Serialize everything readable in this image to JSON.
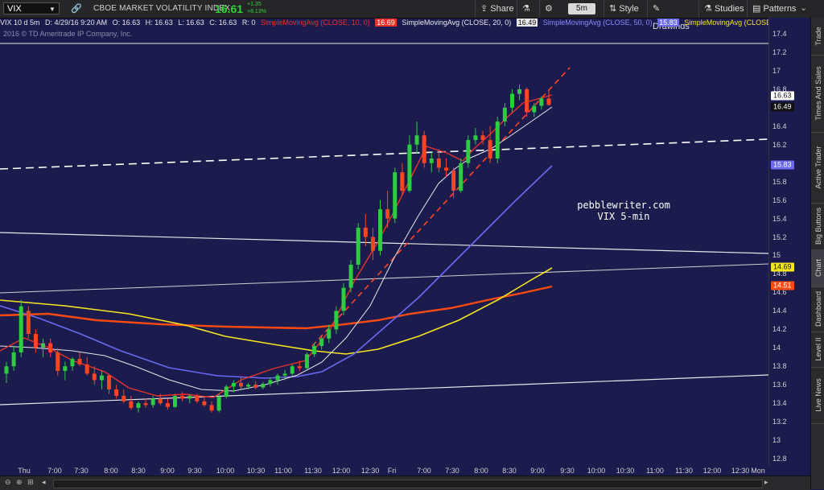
{
  "toolbar": {
    "symbol": "VIX",
    "description": "CBOE MARKET VOLATILITY INDEX",
    "last_price": "16.61",
    "change": "+1.35",
    "change_pct": "+8.13%",
    "share_label": "Share",
    "timeframe": "5m",
    "style_label": "Style",
    "drawings_label": "Drawings",
    "studies_label": "Studies",
    "patterns_label": "Patterns"
  },
  "info_bar": {
    "chart_desc": "VIX 10 d 5m",
    "datetime": "D: 4/29/16 9:20 AM",
    "open": "O: 16.63",
    "high": "H: 16.63",
    "low": "L: 16.63",
    "close": "C: 16.63",
    "range": "R: 0",
    "sma10": "SimpleMovingAvg (CLOSE, 10, 0)",
    "sma10_val": "16.69",
    "sma20": "SimpleMovingAvg (CLOSE, 20, 0)",
    "sma20_val": "16.49",
    "sma50": "SimpleMovingAvg (CLOSE, 50, 0)",
    "sma50_val": "15.83",
    "sma_more": "SimpleMovingAvg (CLOSE,..."
  },
  "copyright": "2016 © TD Ameritrade IP Company, Inc.",
  "annotation": {
    "line1": "pebblewriter.com",
    "line2": "VIX 5-min"
  },
  "side_tabs": [
    "Trade",
    "Times And Sales",
    "Active Trader",
    "Big Buttons",
    "Chart",
    "Dashboard",
    "Level II",
    "Live News"
  ],
  "colors": {
    "background": "#1b1b4e",
    "up_candle": "#2ecc40",
    "down_candle": "#ff4422",
    "sma10": "#e8322a",
    "sma20": "#e8e8e8",
    "sma50": "#6a6af0",
    "sma_yellow": "#f5e61e",
    "sma_orange": "#ff4a12"
  },
  "price_tags": {
    "last": "16.63",
    "sma20": "16.49",
    "sma50": "15.83",
    "yellow": "14.69",
    "orange": "14.51"
  },
  "chart_data": {
    "type": "candlestick",
    "y_ticks": [
      "17.4",
      "17.2",
      "17",
      "16.8",
      "16.6",
      "16.4",
      "16.2",
      "16",
      "15.8",
      "15.6",
      "15.4",
      "15.2",
      "15",
      "14.8",
      "14.6",
      "14.4",
      "14.2",
      "14",
      "13.8",
      "13.6",
      "13.4",
      "13.2",
      "13",
      "12.8"
    ],
    "x_ticks": [
      "Thu",
      "7:00",
      "7:30",
      "8:00",
      "8:30",
      "9:00",
      "9:30",
      "10:00",
      "10:30",
      "11:00",
      "11:30",
      "12:00",
      "12:30",
      "Fri",
      "7:00",
      "7:30",
      "8:00",
      "8:30",
      "9:00",
      "9:30",
      "10:00",
      "10:30",
      "11:00",
      "11:30",
      "12:00",
      "12:30",
      "Mon"
    ],
    "ylim": [
      12.7,
      17.55
    ],
    "candles": [
      [
        13.72,
        13.85,
        13.62,
        13.8
      ],
      [
        13.8,
        14.02,
        13.75,
        13.95
      ],
      [
        13.95,
        14.52,
        13.9,
        14.45
      ],
      [
        14.4,
        14.45,
        14.1,
        14.15
      ],
      [
        14.15,
        14.2,
        13.95,
        14.0
      ],
      [
        14.0,
        14.1,
        13.9,
        14.05
      ],
      [
        14.05,
        14.1,
        13.9,
        13.95
      ],
      [
        13.95,
        14.0,
        13.7,
        13.75
      ],
      [
        13.75,
        13.85,
        13.65,
        13.8
      ],
      [
        13.8,
        13.9,
        13.75,
        13.88
      ],
      [
        13.88,
        13.95,
        13.8,
        13.82
      ],
      [
        13.82,
        13.9,
        13.7,
        13.72
      ],
      [
        13.72,
        13.8,
        13.6,
        13.65
      ],
      [
        13.65,
        13.75,
        13.55,
        13.7
      ],
      [
        13.7,
        13.72,
        13.5,
        13.55
      ],
      [
        13.55,
        13.6,
        13.45,
        13.48
      ],
      [
        13.48,
        13.55,
        13.4,
        13.42
      ],
      [
        13.42,
        13.48,
        13.33,
        13.35
      ],
      [
        13.35,
        13.42,
        13.3,
        13.4
      ],
      [
        13.4,
        13.45,
        13.35,
        13.38
      ],
      [
        13.38,
        13.48,
        13.35,
        13.45
      ],
      [
        13.45,
        13.5,
        13.38,
        13.4
      ],
      [
        13.4,
        13.45,
        13.33,
        13.36
      ],
      [
        13.36,
        13.5,
        13.35,
        13.48
      ],
      [
        13.48,
        13.52,
        13.42,
        13.45
      ],
      [
        13.45,
        13.5,
        13.4,
        13.48
      ],
      [
        13.48,
        13.5,
        13.4,
        13.42
      ],
      [
        13.42,
        13.46,
        13.36,
        13.38
      ],
      [
        13.38,
        13.42,
        13.3,
        13.32
      ],
      [
        13.32,
        13.5,
        13.3,
        13.47
      ],
      [
        13.47,
        13.6,
        13.45,
        13.58
      ],
      [
        13.58,
        13.65,
        13.52,
        13.62
      ],
      [
        13.62,
        13.68,
        13.55,
        13.58
      ],
      [
        13.58,
        13.62,
        13.55,
        13.6
      ],
      [
        13.6,
        13.64,
        13.55,
        13.57
      ],
      [
        13.57,
        13.63,
        13.55,
        13.61
      ],
      [
        13.61,
        13.68,
        13.58,
        13.65
      ],
      [
        13.65,
        13.72,
        13.6,
        13.7
      ],
      [
        13.7,
        13.76,
        13.65,
        13.72
      ],
      [
        13.72,
        13.82,
        13.7,
        13.8
      ],
      [
        13.8,
        13.86,
        13.75,
        13.78
      ],
      [
        13.78,
        13.95,
        13.76,
        13.93
      ],
      [
        13.93,
        14.05,
        13.9,
        14.02
      ],
      [
        14.02,
        14.12,
        13.98,
        14.1
      ],
      [
        14.1,
        14.25,
        14.05,
        14.2
      ],
      [
        14.2,
        14.45,
        14.15,
        14.4
      ],
      [
        14.4,
        14.7,
        14.35,
        14.65
      ],
      [
        14.65,
        14.95,
        14.6,
        14.9
      ],
      [
        14.9,
        15.35,
        14.85,
        15.3
      ],
      [
        15.3,
        15.45,
        15.1,
        15.2
      ],
      [
        15.2,
        15.3,
        14.95,
        15.05
      ],
      [
        15.05,
        15.6,
        15.0,
        15.5
      ],
      [
        15.5,
        15.7,
        15.3,
        15.4
      ],
      [
        15.4,
        15.95,
        15.35,
        15.9
      ],
      [
        15.9,
        16.0,
        15.65,
        15.7
      ],
      [
        15.7,
        16.3,
        15.68,
        16.2
      ],
      [
        16.2,
        16.45,
        16.1,
        16.3
      ],
      [
        16.3,
        16.35,
        15.95,
        16.0
      ],
      [
        16.0,
        16.12,
        15.9,
        16.05
      ],
      [
        16.05,
        16.15,
        15.9,
        15.95
      ],
      [
        15.95,
        16.05,
        15.85,
        15.92
      ],
      [
        15.92,
        15.95,
        15.62,
        15.7
      ],
      [
        15.7,
        16.05,
        15.68,
        16.0
      ],
      [
        16.0,
        16.3,
        15.95,
        16.25
      ],
      [
        16.25,
        16.38,
        16.2,
        16.3
      ],
      [
        16.3,
        16.35,
        16.2,
        16.25
      ],
      [
        16.25,
        16.4,
        16.0,
        16.05
      ],
      [
        16.05,
        16.5,
        16.0,
        16.45
      ],
      [
        16.45,
        16.65,
        16.4,
        16.6
      ],
      [
        16.6,
        16.8,
        16.55,
        16.75
      ],
      [
        16.75,
        16.85,
        16.68,
        16.8
      ],
      [
        16.8,
        16.82,
        16.5,
        16.55
      ],
      [
        16.55,
        16.65,
        16.5,
        16.62
      ],
      [
        16.62,
        16.72,
        16.58,
        16.7
      ],
      [
        16.7,
        16.8,
        16.62,
        16.63
      ]
    ]
  }
}
